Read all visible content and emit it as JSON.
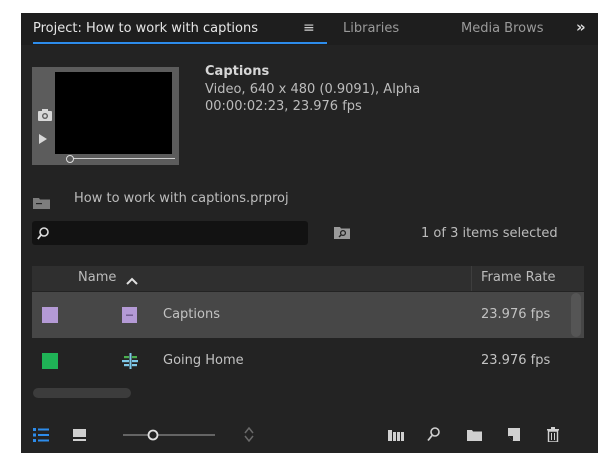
{
  "tabs": {
    "active": "Project: How to work with captions",
    "menu_glyph": "≡",
    "libraries": "Libraries",
    "media_browser": "Media Brows",
    "more_glyph": "»"
  },
  "clip": {
    "title": "Captions",
    "line1": "Video, 640 x 480 (0.9091), Alpha",
    "line2": "00:00:02:23, 23.976 fps"
  },
  "project": {
    "filename": "How to work with captions.prproj"
  },
  "search": {
    "value": "",
    "items_selected": "1 of 3 items selected"
  },
  "list": {
    "columns": {
      "name": "Name",
      "frame_rate": "Frame Rate"
    },
    "rows": [
      {
        "name": "Captions",
        "frame_rate": "23.976 fps",
        "label_color": "#b49ad6",
        "selected": true,
        "icon": "captions-icon"
      },
      {
        "name": "Going Home",
        "frame_rate": "23.976 fps",
        "label_color": "#1fb356",
        "selected": false,
        "icon": "sequence-icon"
      }
    ]
  },
  "toolbar": {
    "icons": [
      "list-view-icon",
      "icon-view-icon",
      "zoom-slider",
      "sort-icons-icon",
      "automate-to-sequence-icon",
      "find-icon",
      "new-bin-icon",
      "new-item-icon",
      "clear-icon"
    ],
    "accent": "#2d8ceb"
  }
}
